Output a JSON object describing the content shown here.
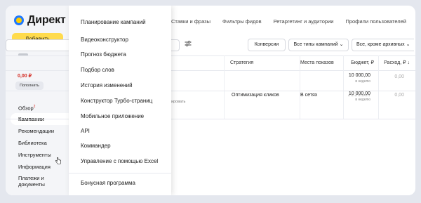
{
  "brand": {
    "name": "Директ"
  },
  "sidebar": {
    "add_label": "Добавить",
    "balance": "0,00 ₽",
    "topup_label": "Пополнить",
    "items": [
      {
        "label": "Обзор",
        "badge": "2"
      },
      {
        "label": "Кампании"
      },
      {
        "label": "Рекомендации"
      },
      {
        "label": "Библиотека"
      },
      {
        "label": "Инструменты"
      },
      {
        "label": "Информация"
      },
      {
        "label": "Платежи и документы"
      }
    ]
  },
  "tabs": [
    "Ставки и фразы",
    "Фильтры фидов",
    "Ретаргетинг и аудитории",
    "Профили пользователей"
  ],
  "filters": {
    "conversions": "Конверсии",
    "campaign_types": "Все типы кампаний",
    "archive": "Все, кроме архивных"
  },
  "table": {
    "headers": {
      "strategy": "Стратегия",
      "placements": "Места показов",
      "budget": "Бюджет, ₽",
      "spend": "Расход, ₽"
    },
    "rows": [
      {
        "strategy": "",
        "placements": "",
        "budget": "10 000,00",
        "budget_period": "в неделю",
        "spend": "0,00"
      },
      {
        "strategy": "Оптимизация кликов",
        "placements": "В сетях",
        "budget": "10 000,00",
        "budget_period": "в неделю",
        "spend": "0,00",
        "peek": "ировать"
      }
    ]
  },
  "menu": {
    "items": [
      "Планирование кампаний",
      "Видеоконструктор",
      "Прогноз бюджета",
      "Подбор слов",
      "История изменений",
      "Конструктор Турбо-страниц",
      "Мобильное приложение",
      "API",
      "Коммандер",
      "Управление с помощью Excel"
    ],
    "bonus": "Бонусная программа"
  },
  "colors": {
    "accent": "#ffdb4d",
    "brand_blue": "#1e78ff",
    "negative": "#d3281f"
  }
}
